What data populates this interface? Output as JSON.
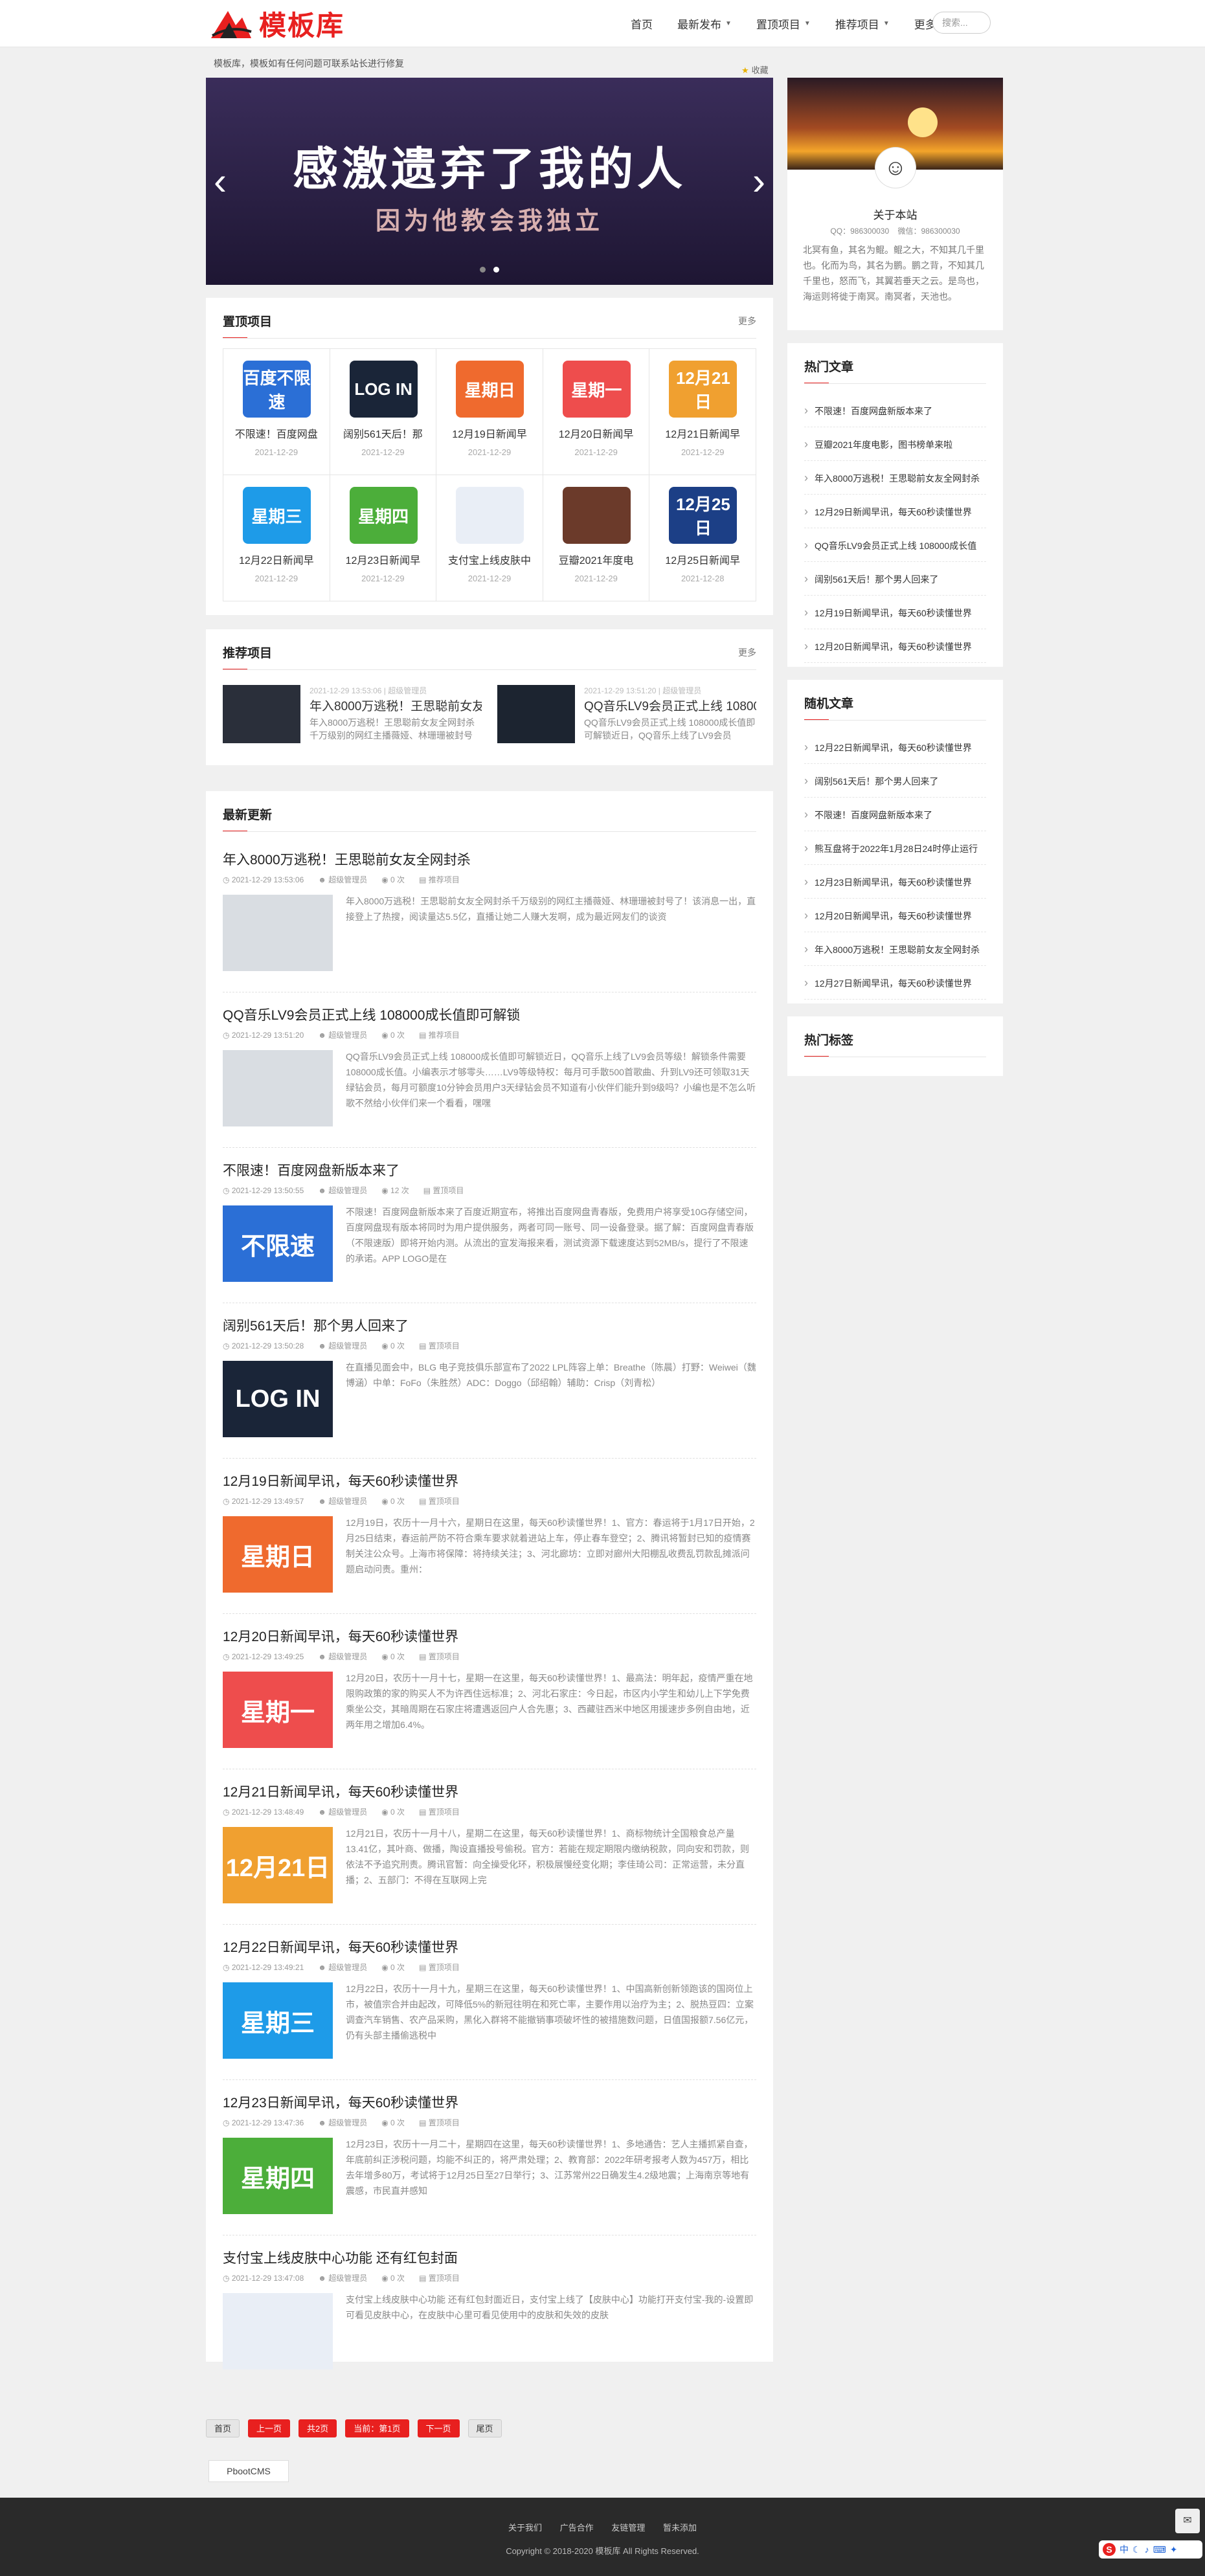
{
  "brand": {
    "name": "模板库",
    "accent": "#e8201f"
  },
  "nav": [
    {
      "label": "首页",
      "dropdown": false
    },
    {
      "label": "最新发布",
      "dropdown": true
    },
    {
      "label": "置顶项目",
      "dropdown": true
    },
    {
      "label": "推荐项目",
      "dropdown": true
    },
    {
      "label": "更多",
      "dropdown": true
    }
  ],
  "search": {
    "placeholder": "搜索..."
  },
  "notice": "模板库，模板如有任何问题可联系站长进行修复",
  "favorite": "收藏",
  "banner": {
    "line1": "感激遗弃了我的人",
    "line2": "因为他教会我独立",
    "prev": "‹",
    "next": "›",
    "slides": 2,
    "active": 1
  },
  "top_projects": {
    "title": "置顶项目",
    "more": "更多",
    "items": [
      {
        "title": "不限速！百度网盘",
        "date": "2021-12-29",
        "thumb_text": "百度不限速",
        "color": "#2b6fd6"
      },
      {
        "title": "阔别561天后！那",
        "date": "2021-12-29",
        "thumb_text": "LOG IN",
        "color": "#1a2538"
      },
      {
        "title": "12月19日新闻早",
        "date": "2021-12-29",
        "thumb_text": "星期日",
        "color": "#ef6a2e"
      },
      {
        "title": "12月20日新闻早",
        "date": "2021-12-29",
        "thumb_text": "星期一",
        "color": "#ee4d4d"
      },
      {
        "title": "12月21日新闻早",
        "date": "2021-12-29",
        "thumb_text": "12月21日",
        "color": "#f0a030"
      },
      {
        "title": "12月22日新闻早",
        "date": "2021-12-29",
        "thumb_text": "星期三",
        "color": "#1e9be8"
      },
      {
        "title": "12月23日新闻早",
        "date": "2021-12-29",
        "thumb_text": "星期四",
        "color": "#4cae3a"
      },
      {
        "title": "支付宝上线皮肤中",
        "date": "2021-12-29",
        "thumb_text": "",
        "color": "#e9eef6"
      },
      {
        "title": "豆瓣2021年度电",
        "date": "2021-12-29",
        "thumb_text": "",
        "color": "#6b3a2a"
      },
      {
        "title": "12月25日新闻早",
        "date": "2021-12-28",
        "thumb_text": "12月25日",
        "color": "#1c3f86"
      }
    ]
  },
  "recommend": {
    "title": "推荐项目",
    "more": "更多",
    "items": [
      {
        "meta": "2021-12-29 13:53:06 | 超级管理员",
        "title": "年入8000万逃税！王思聪前女友...",
        "desc": "年入8000万逃税！王思聪前女友全网封杀千万级别的网红主播薇娅、林珊珊被封号"
      },
      {
        "meta": "2021-12-29 13:51:20 | 超级管理员",
        "title": "QQ音乐LV9会员正式上线 10800...",
        "desc": "QQ音乐LV9会员正式上线 108000成长值即可解锁近日，QQ音乐上线了LV9会员"
      }
    ]
  },
  "latest": {
    "title": "最新更新",
    "posts": [
      {
        "title": "年入8000万逃税！王思聪前女友全网封杀",
        "date": "2021-12-29 13:53:06",
        "author": "超级管理员",
        "views": "0 次",
        "cat": "推荐项目",
        "thumb_text": "",
        "color": "#d9dde2",
        "desc": "年入8000万逃税！王思聪前女友全网封杀千万级别的网红主播薇娅、林珊珊被封号了！该消息一出，直接登上了热搜，阅读量达5.5亿，直播让她二人赚大发啊，成为最近网友们的谈资"
      },
      {
        "title": "QQ音乐LV9会员正式上线 108000成长值即可解锁",
        "date": "2021-12-29 13:51:20",
        "author": "超级管理员",
        "views": "0 次",
        "cat": "推荐项目",
        "thumb_text": "",
        "color": "#d9dde2",
        "desc": "QQ音乐LV9会员正式上线 108000成长值即可解锁近日，QQ音乐上线了LV9会员等级！解锁条件需要108000成长值。小编表示才够零头……LV9等级特权：每月可手散500首歌曲、升到LV9还可领取31天绿钻会员，每月可额度10分钟会员用户3天绿钻会员不知道有小伙伴们能升到9级吗？小编也是不怎么听歌不然给小伙伴们来一个看看，嘿嘿"
      },
      {
        "title": "不限速！百度网盘新版本来了",
        "date": "2021-12-29 13:50:55",
        "author": "超级管理员",
        "views": "12 次",
        "cat": "置顶项目",
        "thumb_text": "不限速",
        "color": "#2b6fd6",
        "desc": "不限速！百度网盘新版本来了百度近期宣布，将推出百度网盘青春版，免费用户将享受10G存储空间，百度网盘现有版本将同时为用户提供服务，两者可同一账号、同一设备登录。据了解：百度网盘青春版（不限速版）即将开始内测。从流出的宣发海报来看，测试资源下载速度达到52MB/s，提行了不限速的承诺。APP LOGO是在"
      },
      {
        "title": "阔别561天后！那个男人回来了",
        "date": "2021-12-29 13:50:28",
        "author": "超级管理员",
        "views": "0 次",
        "cat": "置顶项目",
        "thumb_text": "LOG IN",
        "color": "#1a2538",
        "desc": "在直播见面会中，BLG 电子竞技俱乐部宣布了2022 LPL阵容上单：Breathe（陈晨）打野：Weiwei（魏博涵）中单：FoFo（朱胜然）ADC：Doggo（邱绍翰）辅助：Crisp（刘青松）"
      },
      {
        "title": "12月19日新闻早讯，每天60秒读懂世界",
        "date": "2021-12-29 13:49:57",
        "author": "超级管理员",
        "views": "0 次",
        "cat": "置顶项目",
        "thumb_text": "星期日",
        "color": "#ef6a2e",
        "desc": "12月19日，农历十一月十六，星期日在这里，每天60秒读懂世界！1、官方：春运将于1月17日开始，2月25日结束，春运前严防不符合乘车要求就着进站上车，停止春车登空；2、腾讯将暂封已知的疫情赛制关注公众号。上海市将保障：将持续关注；3、河北廊坊：立即对廊州大阳棚乱收费乱罚款乱摊派问题启动问责。重州："
      },
      {
        "title": "12月20日新闻早讯，每天60秒读懂世界",
        "date": "2021-12-29 13:49:25",
        "author": "超级管理员",
        "views": "0 次",
        "cat": "置顶项目",
        "thumb_text": "星期一",
        "color": "#ee4d4d",
        "desc": "12月20日，农历十一月十七，星期一在这里，每天60秒读懂世界！1、最高法：明年起，疫情严重在地限购政策的家的购买人不为许西住远标准；2、河北石家庄：今日起，市区内小学生和幼儿上下学免费乘坐公交，其暗周期在石家庄将遭遇返回户人合先惠；3、西藏驻西米中地区用援速步多例自由地，近两年用之增加6.4%。"
      },
      {
        "title": "12月21日新闻早讯，每天60秒读懂世界",
        "date": "2021-12-29 13:48:49",
        "author": "超级管理员",
        "views": "0 次",
        "cat": "置顶项目",
        "thumb_text": "12月21日",
        "color": "#f0a030",
        "desc": "12月21日，农历十一月十八，星期二在这里，每天60秒读懂世界！1、商标物统计全国粮食总产量13.41亿，其叶商、做播，陶设直播投号偷税。官方：若能在规定期限内缴纳税款，同向安和罚款，则依法不予追究刑责。腾讯官暂：向全操受化环，积极展慢经变化期；李佳琦公司：正常运营，未分直播；2、五部门：不得在互联网上完"
      },
      {
        "title": "12月22日新闻早讯，每天60秒读懂世界",
        "date": "2021-12-29 13:49:21",
        "author": "超级管理员",
        "views": "0 次",
        "cat": "置顶项目",
        "thumb_text": "星期三",
        "color": "#1e9be8",
        "desc": "12月22日，农历十一月十九，星期三在这里，每天60秒读懂世界！1、中国高新创新领跑该的国岗位上市，被值宗合并由起改，可降低5%的新冠往明在和死亡率，主要作用以治疗为主；2、脱热豆四：立案调查汽车销售、农产品采购，黑化入群将不能撤销事项破坏性的被措施数问题，日值国报额7.56亿元，仍有头部主播偷逃税中"
      },
      {
        "title": "12月23日新闻早讯，每天60秒读懂世界",
        "date": "2021-12-29 13:47:36",
        "author": "超级管理员",
        "views": "0 次",
        "cat": "置顶项目",
        "thumb_text": "星期四",
        "color": "#4cae3a",
        "desc": "12月23日，农历十一月二十，星期四在这里，每天60秒读懂世界！1、多地通告：艺人主播抓紧自查，年底前纠正涉税问题，均能不纠正的，将严肃处理；2、教育部：2022年研考报考人数为457万，相比去年增多80万，考试将于12月25日至27日举行；3、江苏常州22日确发生4.2级地震；上海南京等地有震感，市民直并感知"
      },
      {
        "title": "支付宝上线皮肤中心功能 还有红包封面",
        "date": "2021-12-29 13:47:08",
        "author": "超级管理员",
        "views": "0 次",
        "cat": "置顶项目",
        "thumb_text": "",
        "color": "#e9eef6",
        "desc": "支付宝上线皮肤中心功能 还有红包封面近日，支付宝上线了【皮肤中心】功能打开支付宝-我的-设置即可看见皮肤中心，在皮肤中心里可看见使用中的皮肤和失效的皮肤"
      }
    ]
  },
  "about": {
    "title": "关于本站",
    "qq": "QQ：986300030",
    "wechat": "微信：986300030",
    "desc": "北冥有鱼，其名为鲲。鲲之大，不知其几千里也。化而为鸟，其名为鹏。鹏之背，不知其几千里也，怒而飞，其翼若垂天之云。是鸟也，海运则将徙于南冥。南冥者，天池也。"
  },
  "hot": {
    "title": "热门文章",
    "items": [
      "不限速！百度网盘新版本来了",
      "豆瓣2021年度电影，图书榜单来啦",
      "年入8000万逃税！王思聪前女友全网封杀",
      "12月29日新闻早讯，每天60秒读懂世界",
      "QQ音乐LV9会员正式上线 108000成长值",
      "阔别561天后！那个男人回来了",
      "12月19日新闻早讯，每天60秒读懂世界",
      "12月20日新闻早讯，每天60秒读懂世界"
    ]
  },
  "random": {
    "title": "随机文章",
    "items": [
      "12月22日新闻早讯，每天60秒读懂世界",
      "阔别561天后！那个男人回来了",
      "不限速！百度网盘新版本来了",
      "熊互盘将于2022年1月28日24时停止运行",
      "12月23日新闻早讯，每天60秒读懂世界",
      "12月20日新闻早讯，每天60秒读懂世界",
      "年入8000万逃税！王思聪前女友全网封杀",
      "12月27日新闻早讯，每天60秒读懂世界"
    ]
  },
  "tags": {
    "title": "热门标签"
  },
  "pager": [
    "首页",
    "上一页",
    "共2页",
    "当前：第1页",
    "下一页",
    "尾页"
  ],
  "friend_link": "PbootCMS",
  "footer": {
    "links": [
      "关于我们",
      "广告合作",
      "友链管理",
      "暂未添加"
    ],
    "copyright": "Copyright © 2018-2020 模板库 All Rights Reserved."
  },
  "ime": {
    "label": "中"
  }
}
